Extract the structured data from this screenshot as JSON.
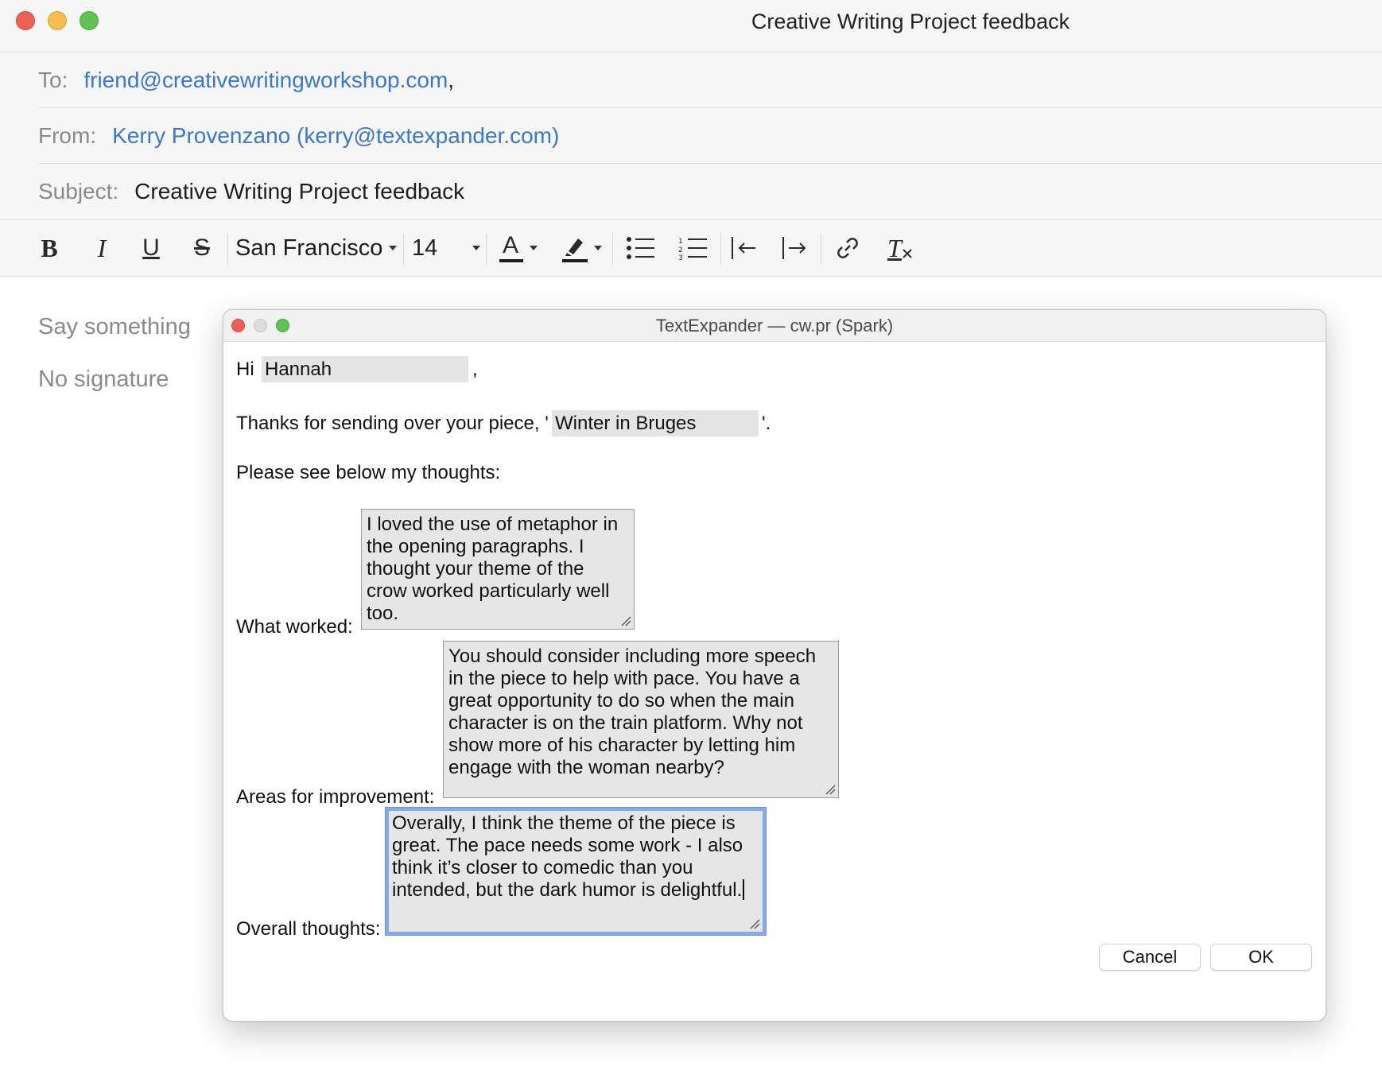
{
  "window": {
    "title": "Creative Writing Project feedback"
  },
  "header": {
    "to_label": "To:",
    "to_value": "friend@creativewritingworkshop.com",
    "to_sep": ",",
    "from_label": "From:",
    "from_value": "Kerry Provenzano (kerry@textexpander.com)",
    "subject_label": "Subject:",
    "subject_value": "Creative Writing Project feedback"
  },
  "toolbar": {
    "bold": "B",
    "italic": "I",
    "underline": "U",
    "strike": "S",
    "font_name": "San Francisco",
    "font_size": "14",
    "text_color_glyph": "A",
    "clear_format_glyph": "T",
    "text_color": "#1d1d1f",
    "highlight_color": "#1d1d1f"
  },
  "body": {
    "say_something": "Say something",
    "no_signature": "No signature"
  },
  "dialog": {
    "title": "TextExpander — cw.pr (Spark)",
    "greeting_prefix": "Hi",
    "name_value": "Hannah",
    "greeting_suffix": ",",
    "thanks_prefix": "Thanks for sending over your piece, '",
    "piece_value": "Winter in Bruges",
    "thanks_suffix": "'.",
    "see_below": "Please see below my thoughts:",
    "worked_label": "What worked:",
    "worked_value": "I loved the use of metaphor in the opening paragraphs. I thought your theme of the crow worked particularly well too.",
    "improve_label": "Areas for improvement:",
    "improve_value": "You should consider including more speech in the piece to help with pace. You have a great opportunity to do so when the main character is on the train platform. Why not show more of his character by letting him engage with the woman nearby?",
    "overall_label": "Overall thoughts:",
    "overall_value": "Overally, I think the theme of the piece is great. The pace needs some work - I also think it’s closer to comedic than you intended, but the dark humor is delightful.",
    "cancel_label": "Cancel",
    "ok_label": "OK"
  },
  "colors": {
    "link": "#3a77d0",
    "label_gray": "#8a8a8e",
    "focus_ring": "#86a9ea",
    "field_fill": "#e4e4e4"
  }
}
